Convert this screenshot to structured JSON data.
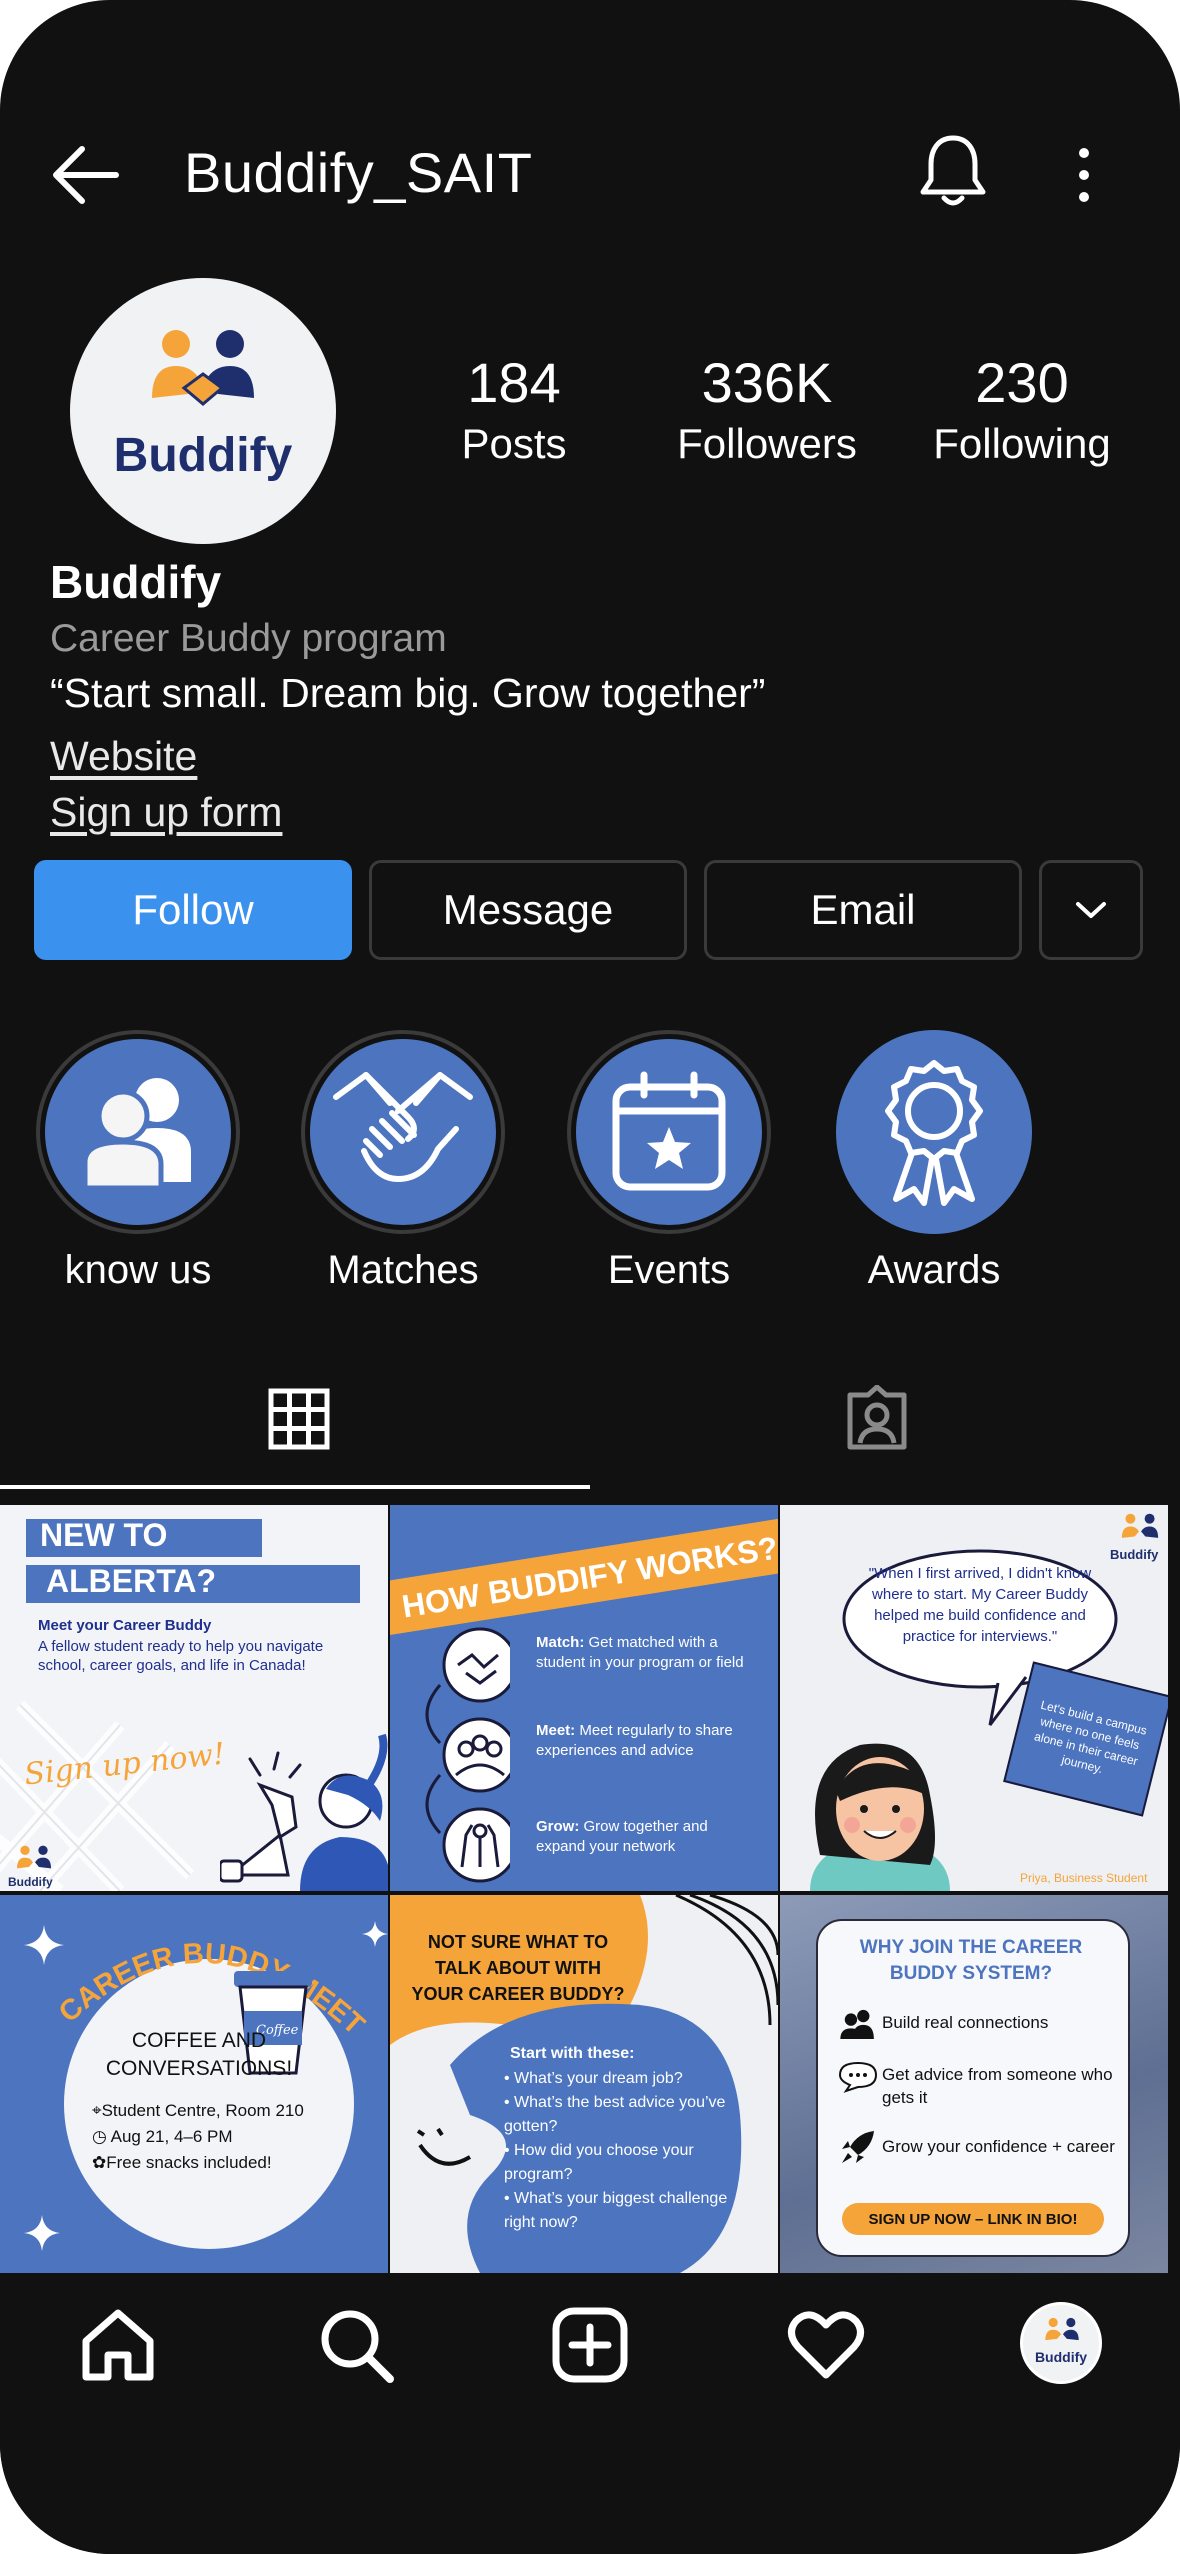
{
  "header": {
    "title": "Buddify_SAIT"
  },
  "profile": {
    "avatar_text": "Buddify",
    "stats": [
      {
        "value": "184",
        "label": "Posts"
      },
      {
        "value": "336K",
        "label": "Followers"
      },
      {
        "value": "230",
        "label": "Following"
      }
    ],
    "name": "Buddify",
    "category": "Career Buddy program",
    "bio": "“Start small. Dream big. Grow together”",
    "links": [
      "Website",
      "Sign up form"
    ]
  },
  "actions": {
    "follow": "Follow",
    "message": "Message",
    "email": "Email"
  },
  "highlights": [
    {
      "label": "know us",
      "icon": "people-icon"
    },
    {
      "label": "Matches",
      "icon": "handshake-icon"
    },
    {
      "label": "Events",
      "icon": "calendar-star-icon"
    },
    {
      "label": "Awards",
      "icon": "award-ribbon-icon"
    }
  ],
  "tabs": [
    {
      "icon": "grid-icon",
      "active": true
    },
    {
      "icon": "tagged-person-icon",
      "active": false
    }
  ],
  "posts": {
    "p1": {
      "title1": "NEW TO",
      "title2": "ALBERTA?",
      "heading": "Meet your Career Buddy",
      "body": "A fellow student ready to help you navigate school, career goals, and life in Canada!",
      "script": "Sign up now!",
      "logo": "Buddify"
    },
    "p2": {
      "banner": "HOW BUDDIFY WORKS?",
      "steps": [
        {
          "bold": "Match:",
          "text": " Get matched with a student in your program or field"
        },
        {
          "bold": "Meet:",
          "text": " Meet regularly to share experiences and advice"
        },
        {
          "bold": "Grow:",
          "text": " Grow together and expand your network"
        }
      ]
    },
    "p3": {
      "logo": "Buddify",
      "quote": "\"When I first arrived, I didn't know where to start. My Career Buddy helped me build confidence and practice for interviews.\"",
      "note": "Let's build a campus where no one feels alone in their career journey.",
      "credit": "Priya, Business Student"
    },
    "p4": {
      "arc": "CAREER BUDDY MEETUP",
      "cup": "Coffee",
      "title": "COFFEE AND CONVERSATIONS!",
      "location": "Student Centre, Room 210",
      "time": "Aug 21, 4–6 PM",
      "snacks": "Free snacks included!"
    },
    "p5": {
      "heading": "NOT SURE WHAT TO TALK ABOUT WITH YOUR CAREER BUDDY?",
      "start": "Start with these:",
      "items": [
        "• What’s your dream job?",
        "• What’s the best advice you’ve gotten?",
        "• How did you choose your program?",
        "• What’s your biggest challenge right now?"
      ]
    },
    "p6": {
      "heading": "WHY JOIN THE CAREER BUDDY SYSTEM?",
      "items": [
        "Build real connections",
        "Get advice from someone who gets it",
        "Grow your confidence + career"
      ],
      "cta": "SIGN UP NOW – LINK IN BIO!"
    }
  },
  "bottom_nav": [
    {
      "icon": "home-icon"
    },
    {
      "icon": "search-icon"
    },
    {
      "icon": "add-post-icon"
    },
    {
      "icon": "heart-icon"
    },
    {
      "icon": "profile-avatar"
    }
  ],
  "colors": {
    "background": "#111111",
    "follow": "#3a91ee",
    "brand_blue": "#4c74bf",
    "brand_orange": "#f5a43a",
    "navy": "#1f2f6e"
  }
}
